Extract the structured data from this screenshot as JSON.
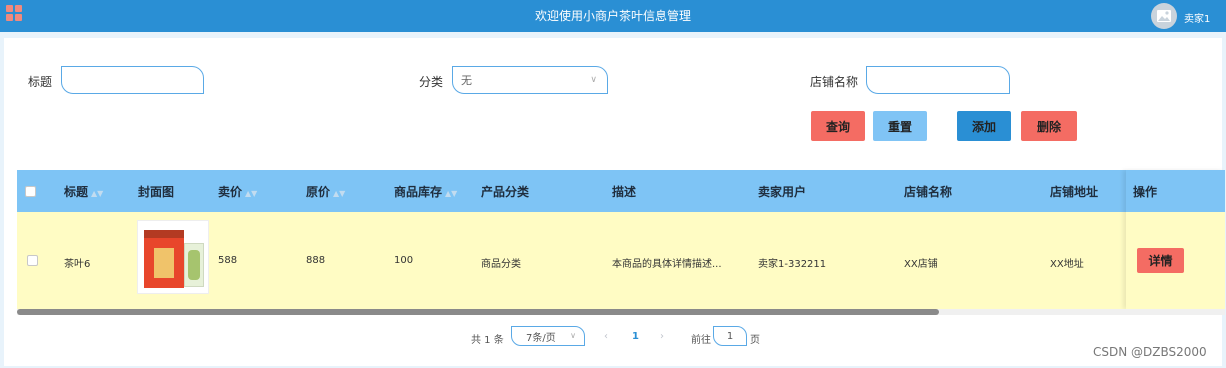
{
  "header": {
    "title": "欢迎使用小商户茶叶信息管理",
    "user": "卖家1",
    "app_icon": "grid-icon",
    "avatar_icon": "image-icon"
  },
  "filters": {
    "title_label": "标题",
    "title_value": "",
    "category_label": "分类",
    "category_value": "无",
    "shop_label": "店铺名称",
    "shop_value": ""
  },
  "actions": {
    "query": "查询",
    "reset": "重置",
    "add": "添加",
    "delete": "删除"
  },
  "colors": {
    "header": "#2a8fd4",
    "table_header": "#7ec4f5",
    "row_highlight": "#fffcc4",
    "query": "#f46c63",
    "reset": "#80c4f5",
    "add": "#2a8fd4",
    "delete": "#f46c63"
  },
  "table": {
    "columns": [
      "标题",
      "封面图",
      "卖价",
      "原价",
      "商品库存",
      "产品分类",
      "描述",
      "卖家用户",
      "店铺名称",
      "店铺地址",
      "操作"
    ],
    "rows": [
      {
        "title": "茶叶6",
        "price": "588",
        "original_price": "888",
        "stock": "100",
        "category": "商品分类",
        "description": "本商品的具体详情描述...",
        "seller": "卖家1-332211",
        "shop_name": "XX店铺",
        "shop_address": "XX地址",
        "action": "详情"
      }
    ]
  },
  "pagination": {
    "total": "共 1 条",
    "page_size": "7条/页",
    "prev": "‹",
    "current": "1",
    "next": "›",
    "goto_label": "前往",
    "goto_value": "1",
    "goto_suffix": "页"
  },
  "watermark": "CSDN @DZBS2000"
}
